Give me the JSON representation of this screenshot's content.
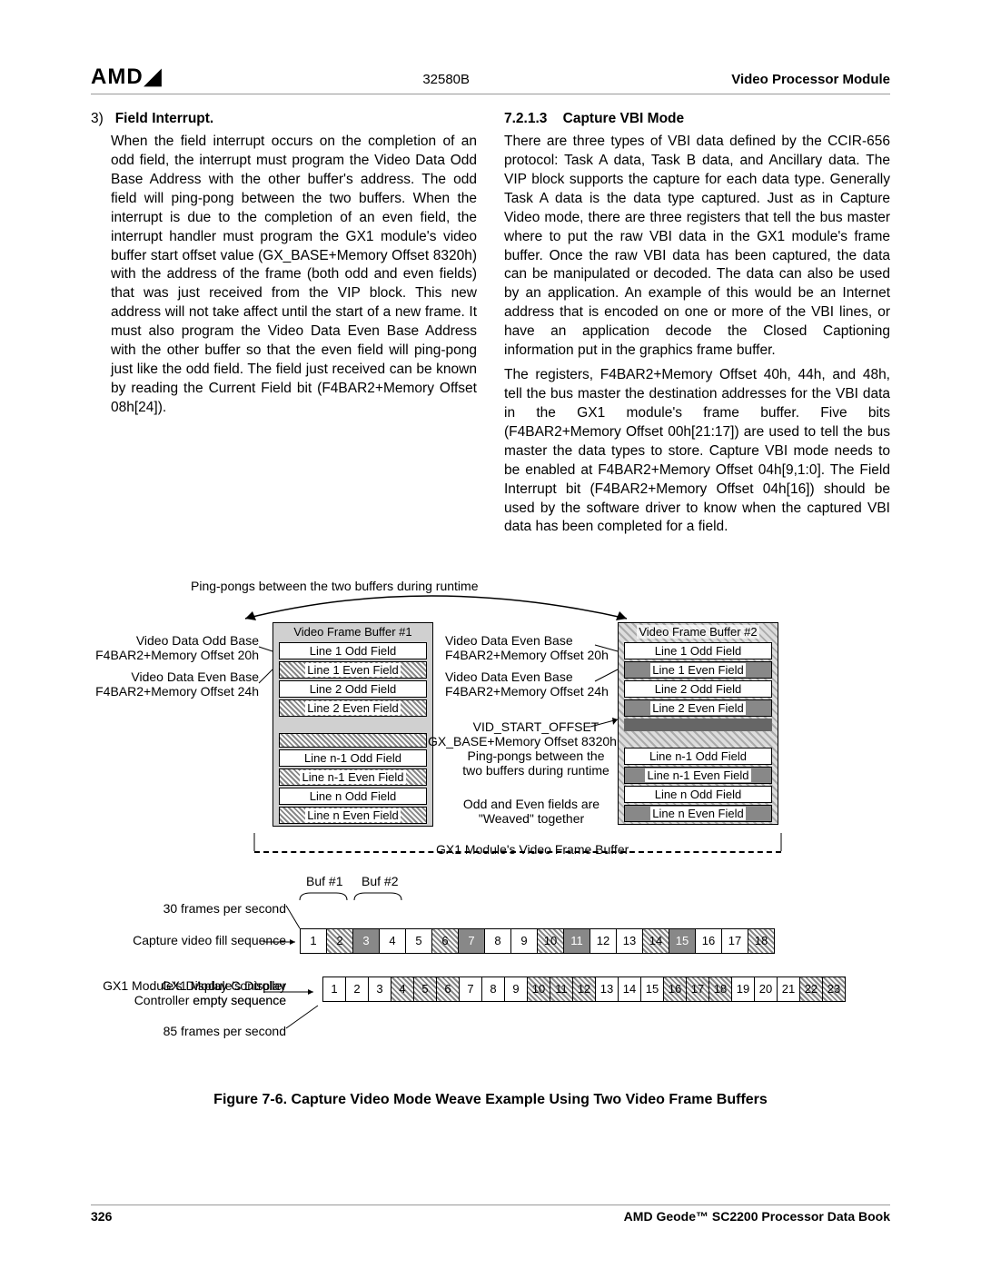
{
  "header": {
    "logo": "AMD",
    "doc_number": "32580B",
    "section": "Video Processor Module"
  },
  "left_column": {
    "item_number": "3)",
    "item_title": "Field Interrupt.",
    "paragraph": "When the field interrupt occurs on the completion of an odd field, the interrupt must program the Video Data Odd Base Address with the other buffer's address. The odd field will ping-pong between the two buffers. When the interrupt is due to the completion of an even field, the interrupt handler must program the GX1 module's video buffer start offset value (GX_BASE+Memory Offset 8320h) with the address of the frame (both odd and even fields) that was just received from the VIP block. This new address will not take affect until the start of a new frame. It must also program the Video Data Even Base Address with the other buffer so that the even field will ping-pong just like the odd field. The field just received can be known by reading the Current Field bit (F4BAR2+Memory Offset 08h[24])."
  },
  "right_column": {
    "heading_number": "7.2.1.3",
    "heading_title": "Capture VBI Mode",
    "paragraph1": "There are three types of VBI data defined by the CCIR-656 protocol: Task A data, Task B data, and Ancillary data. The VIP block supports the capture for each data type. Generally Task A data is the data type captured. Just as in Capture Video mode, there are three registers that tell the bus master where to put the raw VBI data in the GX1 module's frame buffer. Once the raw VBI data has been captured, the data can be manipulated or decoded. The data can also be used by an application. An example of this would be an Internet address that is encoded on one or more of the VBI lines, or have an application decode the Closed Captioning information put in the graphics frame buffer.",
    "paragraph2": "The registers, F4BAR2+Memory Offset 40h, 44h, and 48h, tell the bus master the destination addresses for the VBI data in the GX1 module's frame buffer. Five bits (F4BAR2+Memory Offset 00h[21:17]) are used to tell the bus master the data types to store. Capture VBI mode needs to be enabled at F4BAR2+Memory Offset 04h[9,1:0]. The Field Interrupt bit (F4BAR2+Memory Offset 04h[16]) should be used by the software driver to know when the captured VBI data has been completed for a field."
  },
  "figure": {
    "ping_pong_top": "Ping-pongs between the two buffers during runtime",
    "buffer1_title": "Video Frame Buffer #1",
    "buffer2_title": "Video Frame Buffer #2",
    "lines": {
      "l1o": "Line 1 Odd Field",
      "l1e": "Line 1 Even Field",
      "l2o": "Line 2 Odd Field",
      "l2e": "Line 2 Even Field",
      "ln1o": "Line n-1 Odd Field",
      "ln1e": "Line n-1 Even Field",
      "lno": "Line n Odd Field",
      "lne": "Line n Even Field"
    },
    "labels": {
      "vdo_base": "Video Data Odd Base",
      "vdo_addr": "F4BAR2+Memory Offset 20h",
      "vde_base": "Video Data Even Base",
      "vde_addr": "F4BAR2+Memory Offset 24h",
      "vde_base2": "Video Data Even Base",
      "vde_addr2": "F4BAR2+Memory Offset 20h",
      "vde_base3": "Video Data Even Base",
      "vde_addr3": "F4BAR2+Memory Offset 24h",
      "vid_start": "VID_START_OFFSET",
      "vid_start_addr": "GX_BASE+Memory Offset 8320h",
      "ping_pong_mid": "Ping-pongs between the",
      "ping_pong_mid2": "two buffers during runtime",
      "weaved1": "Odd and Even fields are",
      "weaved2": "\"Weaved\" together",
      "gx_frame": "GX1 Module's Video Frame Buffer",
      "buf1": "Buf #1",
      "buf2": "Buf #2",
      "fps30": "30 frames per second",
      "fps85": "85 frames per second",
      "fill_seq": "Capture video fill sequence",
      "empty_seq": "GX1 Module's Display Controller empty sequence"
    },
    "fill_sequence": [
      "1",
      "2",
      "3",
      "4",
      "5",
      "6",
      "7",
      "8",
      "9",
      "10",
      "11",
      "12",
      "13",
      "14",
      "15",
      "16",
      "17",
      "18"
    ],
    "fill_pattern": [
      "plain",
      "hatch",
      "dark",
      "plain",
      "plain",
      "hatch",
      "dark",
      "plain",
      "plain",
      "hatch",
      "dark",
      "plain",
      "plain",
      "hatch",
      "dark",
      "plain",
      "plain",
      "hatch"
    ],
    "empty_sequence": [
      "1",
      "2",
      "3",
      "4",
      "5",
      "6",
      "7",
      "8",
      "9",
      "10",
      "11",
      "12",
      "13",
      "14",
      "15",
      "16",
      "17",
      "18",
      "19",
      "20",
      "21",
      "22",
      "23"
    ],
    "empty_pattern": [
      "plain",
      "plain",
      "plain",
      "hatch",
      "hatch",
      "hatch",
      "plain",
      "plain",
      "plain",
      "hatch",
      "hatch",
      "hatch",
      "plain",
      "plain",
      "plain",
      "hatch",
      "hatch",
      "hatch",
      "plain",
      "plain",
      "plain",
      "hatch",
      "hatch"
    ],
    "caption": "Figure 7-6. Capture Video Mode Weave Example Using Two Video Frame Buffers"
  },
  "footer": {
    "page": "326",
    "book": "AMD Geode™ SC2200  Processor Data Book"
  }
}
